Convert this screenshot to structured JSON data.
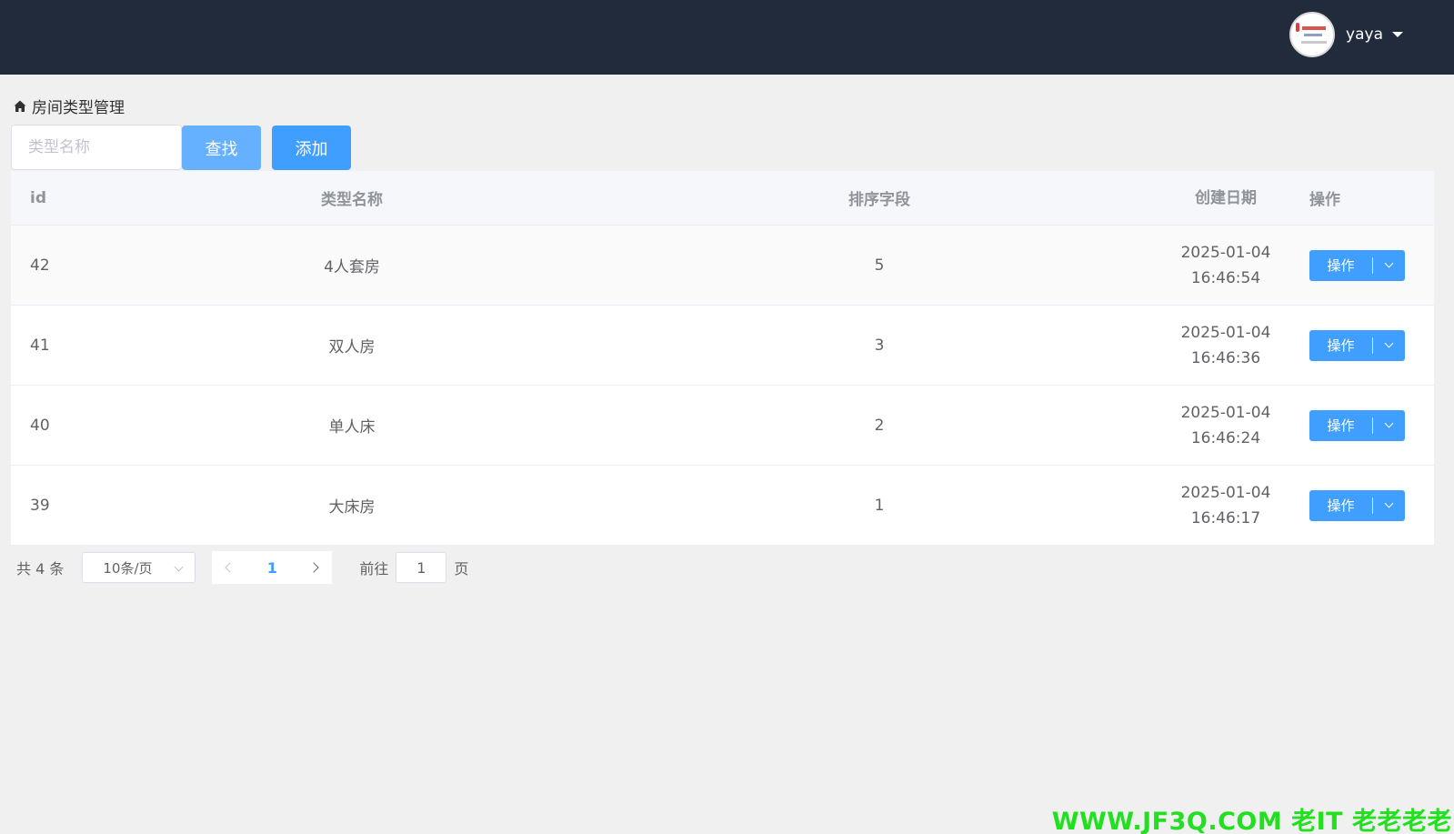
{
  "header": {
    "username": "yaya"
  },
  "breadcrumb": {
    "title": "房间类型管理"
  },
  "toolbar": {
    "search_placeholder": "类型名称",
    "find_label": "查找",
    "add_label": "添加"
  },
  "table": {
    "columns": [
      "id",
      "类型名称",
      "排序字段",
      "创建日期",
      "操作"
    ],
    "rows": [
      {
        "id": "42",
        "name": "4人套房",
        "sort": "5",
        "date": "2025-01-04 16:46:54",
        "action": "操作"
      },
      {
        "id": "41",
        "name": "双人房",
        "sort": "3",
        "date": "2025-01-04 16:46:36",
        "action": "操作"
      },
      {
        "id": "40",
        "name": "单人床",
        "sort": "2",
        "date": "2025-01-04 16:46:24",
        "action": "操作"
      },
      {
        "id": "39",
        "name": "大床房",
        "sort": "1",
        "date": "2025-01-04 16:46:17",
        "action": "操作"
      }
    ]
  },
  "pagination": {
    "total_text": "共 4 条",
    "page_size": "10条/页",
    "current_page": "1",
    "goto_prefix": "前往",
    "goto_value": "1",
    "goto_suffix": "页"
  },
  "watermark": "WWW.JF3Q.COM 老IT  老老老老",
  "colors": {
    "topbar": "#222b3c",
    "primary": "#409eff",
    "primary_light": "#66b1ff",
    "watermark": "#22e01f"
  }
}
